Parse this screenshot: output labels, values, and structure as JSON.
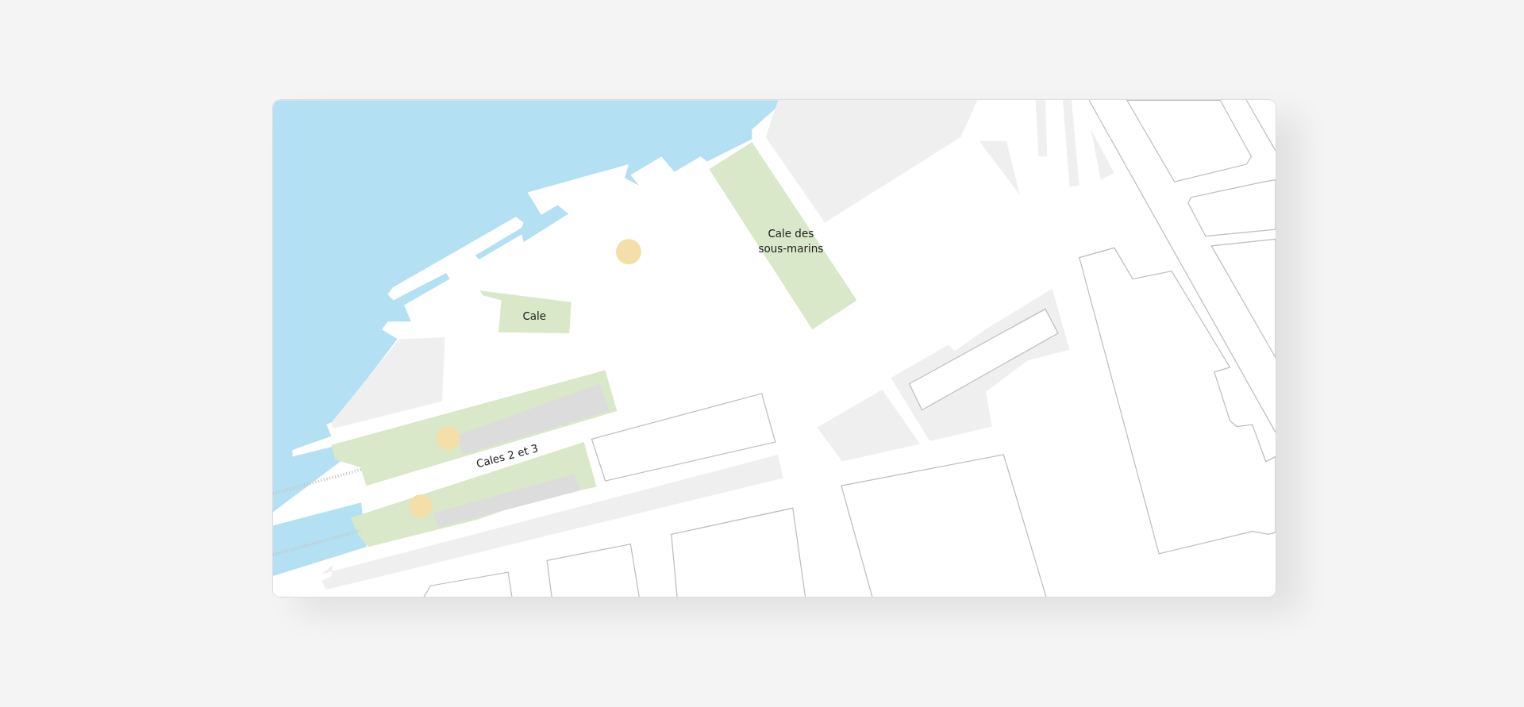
{
  "map": {
    "labels": [
      {
        "kind": "area",
        "lines": [
          "Cale des",
          "sous-marins"
        ]
      },
      {
        "kind": "area",
        "lines": [
          "Cale"
        ]
      },
      {
        "kind": "rotated",
        "lines": [
          "Cales 2 et 3"
        ]
      }
    ]
  }
}
